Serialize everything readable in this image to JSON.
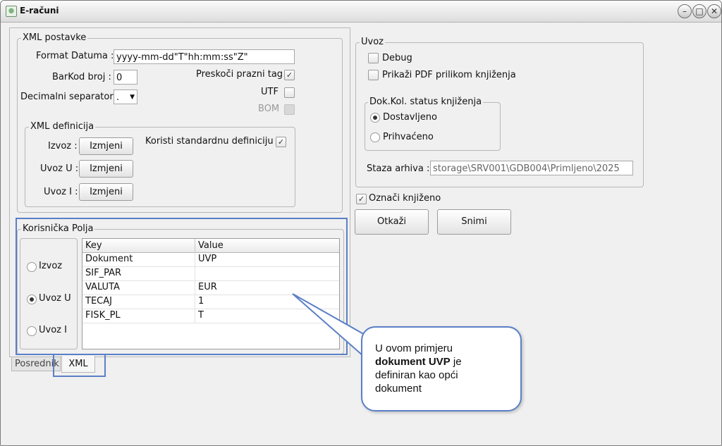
{
  "window": {
    "title": "E-računi",
    "buttons": [
      "minimize",
      "maximize",
      "close"
    ]
  },
  "xml_postavke": {
    "title": "XML postavke",
    "format_datuma_label": "Format Datuma :",
    "format_datuma_value": "yyyy-mm-dd\"T\"hh:mm:ss\"Z\"",
    "barkod_label": "BarKod broj :",
    "barkod_value": "0",
    "decimalni_label": "Decimalni separator :",
    "decimalni_value": ".",
    "preskoci_label": "Preskoči prazni tag",
    "utf_label": "UTF",
    "bom_label": "BOM"
  },
  "xml_definicija": {
    "title": "XML definicija",
    "izvoz_label": "Izvoz :",
    "uvoz_u_label": "Uvoz U :",
    "uvoz_i_label": "Uvoz I :",
    "button_label": "Izmjeni",
    "standard_label": "Koristi standardnu definiciju"
  },
  "korisnicka_polja": {
    "title": "Korisnička Polja",
    "radios": [
      "Izvoz",
      "Uvoz U",
      "Uvoz I"
    ],
    "headers": [
      "Key",
      "Value"
    ],
    "rows": [
      {
        "key": "Dokument",
        "value": "UVP"
      },
      {
        "key": "SIF_PAR",
        "value": ""
      },
      {
        "key": "VALUTA",
        "value": "EUR"
      },
      {
        "key": "TECAJ",
        "value": "1"
      },
      {
        "key": "FISK_PL",
        "value": "T"
      }
    ]
  },
  "tabs": [
    "Posrednik",
    "XML"
  ],
  "uvoz": {
    "title": "Uvoz",
    "debug_label": "Debug",
    "pdf_label": "Prikaži PDF prilikom knjiženja",
    "status_title": "Dok.Kol. status knjiženja",
    "dostavljeno": "Dostavljeno",
    "prihvaceno": "Prihvaćeno",
    "staza_label": "Staza arhiva :",
    "staza_value": "storage\\SRV001\\GDB004\\Primljeno\\2025"
  },
  "oznaci_label": "Označi knjiženo",
  "buttons": {
    "otkazi": "Otkaži",
    "snimi": "Snimi"
  },
  "callout": {
    "line1": "U ovom primjeru",
    "bold": "dokument UVP",
    "after_bold": " je",
    "line3": "definiran kao opći",
    "line4": "dokument"
  },
  "colors": {
    "highlight": "#5b7fc6"
  }
}
